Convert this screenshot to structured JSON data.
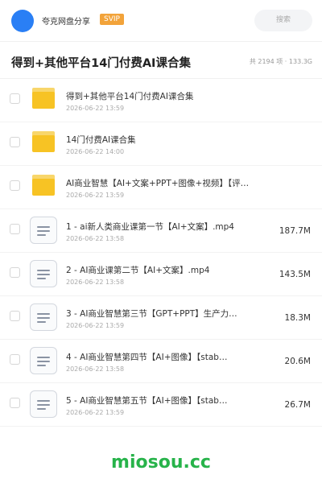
{
  "header": {
    "app_name": "夸克网盘分享",
    "badge": "SVIP",
    "search_label": "搜索",
    "avatar_color": "#2a7ff5"
  },
  "titlebar": {
    "title": "得到+其他平台14门付费AI课合集",
    "summary": "共 2194 项 · 133.3G"
  },
  "files": [
    {
      "type": "folder",
      "icon": "folder-icon",
      "name": "得到+其他平台14门付费AI课合集",
      "date": "2026-06-22 13:59",
      "size": ""
    },
    {
      "type": "folder",
      "icon": "folder-icon",
      "name": "14门付费AI课合集",
      "date": "2026-06-22 14:00",
      "size": ""
    },
    {
      "type": "folder",
      "icon": "folder-icon",
      "name": "AI商业智慧【AI+文案+PPT+图像+视频】【评…",
      "date": "2026-06-22 13:59",
      "size": ""
    },
    {
      "type": "file",
      "icon": "document-icon",
      "name": "1 - ai新人类商业课第一节【AI+文案】.mp4",
      "date": "2026-06-22 13:58",
      "size": "187.7M"
    },
    {
      "type": "file",
      "icon": "document-icon",
      "name": "2 - AI商业课第二节【AI+文案】.mp4",
      "date": "2026-06-22 13:58",
      "size": "143.5M"
    },
    {
      "type": "file",
      "icon": "document-icon",
      "name": "3 - AI商业智慧第三节【GPT+PPT】生产力…",
      "date": "2026-06-22 13:59",
      "size": "18.3M"
    },
    {
      "type": "file",
      "icon": "document-icon",
      "name": "4 - AI商业智慧第四节【AI+图像】【stab…",
      "date": "2026-06-22 13:58",
      "size": "20.6M"
    },
    {
      "type": "file",
      "icon": "document-icon",
      "name": "5 - AI商业智慧第五节【AI+图像】【stab…",
      "date": "2026-06-22 13:59",
      "size": "26.7M"
    }
  ],
  "watermark": "miosou.cc",
  "colors": {
    "accent": "#2a7ff5",
    "badge": "#f2a33a",
    "folder": "#f7c324",
    "watermark": "#27b34a"
  }
}
